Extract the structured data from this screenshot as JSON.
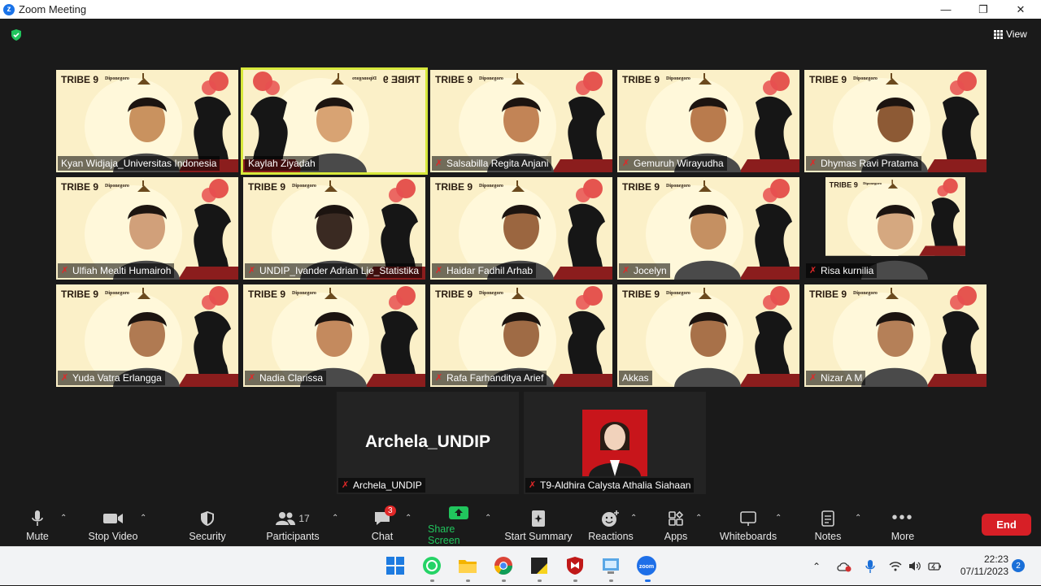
{
  "window": {
    "title": "Zoom Meeting",
    "minimize": "—",
    "restore": "❐",
    "close": "✕"
  },
  "view_label": "View",
  "participants": [
    {
      "name": "Kyan Widjaja_Universitas Indonesia",
      "muted": false,
      "active": false
    },
    {
      "name": "Kaylah Ziyadah",
      "muted": false,
      "active": true
    },
    {
      "name": "Salsabilla Regita Anjani",
      "muted": true,
      "active": false
    },
    {
      "name": "Gemuruh Wirayudha",
      "muted": true,
      "active": false
    },
    {
      "name": "Dhymas Ravi Pratama",
      "muted": true,
      "active": false
    },
    {
      "name": "Ulfiah Mealti Humairoh",
      "muted": true,
      "active": false
    },
    {
      "name": "UNDIP_Ivander Adrian Lie_Statistika",
      "muted": true,
      "active": false
    },
    {
      "name": "Haidar Fadhil Arhab",
      "muted": true,
      "active": false
    },
    {
      "name": "Jocelyn",
      "muted": true,
      "active": false
    },
    {
      "name": "Risa kurnilia",
      "muted": true,
      "active": false
    },
    {
      "name": "Yuda Vatra Erlangga",
      "muted": true,
      "active": false
    },
    {
      "name": "Nadia Clarissa",
      "muted": true,
      "active": false
    },
    {
      "name": "Rafa Farhanditya Arief",
      "muted": true,
      "active": false
    },
    {
      "name": "Akkas",
      "muted": false,
      "active": false
    },
    {
      "name": "Nizar A M",
      "muted": true,
      "active": false
    },
    {
      "name": "Archela_UNDIP",
      "muted": true,
      "active": false,
      "video_off_label": "Archela_UNDIP"
    },
    {
      "name": "T9-Aldhira Calysta Athalia Siahaan",
      "muted": true,
      "active": false
    }
  ],
  "toolbar": {
    "mute": "Mute",
    "stop_video": "Stop Video",
    "security": "Security",
    "participants": "Participants",
    "participants_count": "17",
    "chat": "Chat",
    "chat_badge": "3",
    "share_screen": "Share Screen",
    "start_summary": "Start Summary",
    "reactions": "Reactions",
    "apps": "Apps",
    "whiteboards": "Whiteboards",
    "notes": "Notes",
    "more": "More",
    "end": "End"
  },
  "taskbar": {
    "time": "22:23",
    "date": "07/11/2023",
    "notifications": "2"
  },
  "background_text": {
    "tribe": "TRIBE 9",
    "brand": "Diponegoro"
  },
  "colors": {
    "accent_green": "#21c55d",
    "end_red": "#d71f26",
    "active_outline": "#d7e83b",
    "badge_red": "#e02828"
  }
}
